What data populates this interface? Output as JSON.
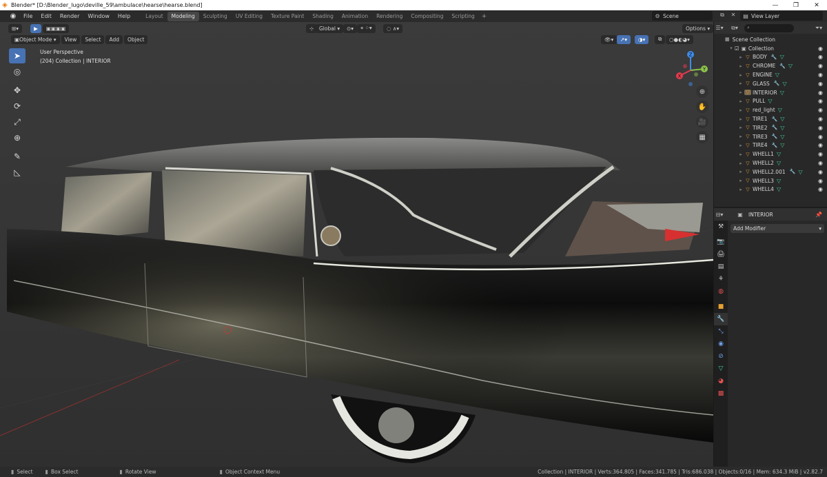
{
  "window": {
    "title": "Blender* [D:\\Blender_lugo\\deville_59\\ambulace\\hearse\\hearse.blend]",
    "controls": [
      "—",
      "❐",
      "✕"
    ]
  },
  "menu": {
    "items": [
      "File",
      "Edit",
      "Render",
      "Window",
      "Help"
    ],
    "workspaces": [
      "Layout",
      "Modeling",
      "Sculpting",
      "UV Editing",
      "Texture Paint",
      "Shading",
      "Animation",
      "Rendering",
      "Compositing",
      "Scripting"
    ],
    "active_workspace": "Modeling",
    "plus": "+",
    "scene": "Scene",
    "view_layer": "View Layer"
  },
  "viewport": {
    "mode": "Object Mode",
    "menus": [
      "View",
      "Select",
      "Add",
      "Object"
    ],
    "transform_orientation": "Global",
    "options": "Options",
    "perspective": "User Perspective",
    "collection_info": "(204) Collection | INTERIOR",
    "gizmo_axes": {
      "x": "X",
      "y": "Y",
      "z": "Z"
    }
  },
  "outliner": {
    "scene_collection": "Scene Collection",
    "collection": "Collection",
    "items": [
      {
        "name": "BODY",
        "mod": true
      },
      {
        "name": "CHROME",
        "mod": true
      },
      {
        "name": "ENGINE",
        "mod": false
      },
      {
        "name": "GLASS",
        "mod": true
      },
      {
        "name": "INTERIOR",
        "mod": false,
        "selected": true
      },
      {
        "name": "PULL",
        "mod": false
      },
      {
        "name": "red_light",
        "mod": false
      },
      {
        "name": "TIRE1",
        "mod": true
      },
      {
        "name": "TIRE2",
        "mod": true
      },
      {
        "name": "TIRE3",
        "mod": true
      },
      {
        "name": "TIRE4",
        "mod": true
      },
      {
        "name": "WHELL1",
        "mod": false
      },
      {
        "name": "WHELL2",
        "mod": false
      },
      {
        "name": "WHELL2.001",
        "mod": true
      },
      {
        "name": "WHELL3",
        "mod": false
      },
      {
        "name": "WHELL4",
        "mod": false
      }
    ]
  },
  "properties": {
    "object_name": "INTERIOR",
    "add_modifier": "Add Modifier"
  },
  "status": {
    "select": "Select",
    "box_select": "Box Select",
    "rotate_view": "Rotate View",
    "context_menu": "Object Context Menu",
    "stats": "Collection | INTERIOR | Verts:364.805 | Faces:341.785 | Tris:686.038 | Objects:0/16 | Mem: 634.3 MiB | v2.82.7"
  },
  "colors": {
    "accent": "#4772b3",
    "selection": "#334d80",
    "object_orange": "#e89b3a",
    "mesh_green": "#3fd0a0",
    "gizmo_x": "#e53b4f",
    "gizmo_y": "#8bc34a",
    "gizmo_z": "#3f8ceb"
  }
}
